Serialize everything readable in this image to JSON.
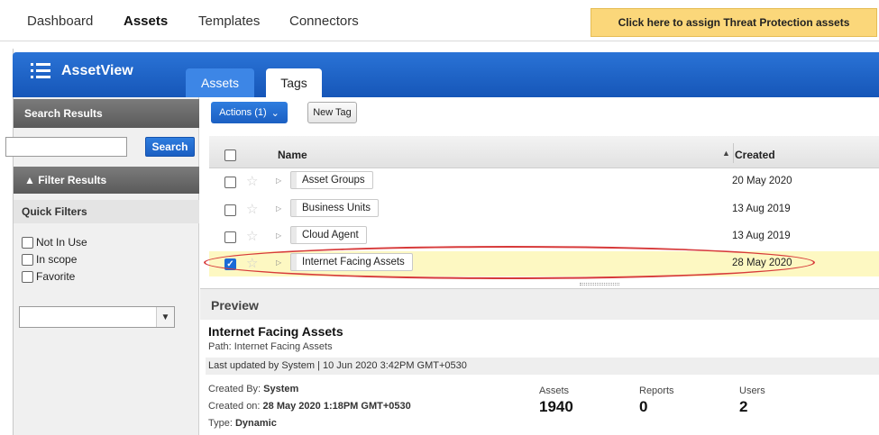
{
  "topnav": {
    "items": [
      "Dashboard",
      "Assets",
      "Templates",
      "Connectors"
    ],
    "active": "Assets",
    "promo": "Click here to assign Threat Protection assets"
  },
  "app": {
    "title": "AssetView",
    "tabs": [
      "Assets",
      "Tags"
    ],
    "selected_tab": "Tags"
  },
  "sidebar": {
    "search_results_title": "Search Results",
    "search_input_value": "",
    "search_button": "Search",
    "filter_title": "▲ Filter Results",
    "quick_filters_title": "Quick Filters",
    "quick_filters": [
      {
        "label": "Not In Use",
        "checked": false
      },
      {
        "label": "In scope",
        "checked": false
      },
      {
        "label": "Favorite",
        "checked": false
      }
    ],
    "select_value": ""
  },
  "toolbar": {
    "actions_label": "Actions (1)",
    "new_tag_label": "New Tag"
  },
  "grid": {
    "columns": {
      "name": "Name",
      "created": "Created",
      "sort_indicator": "▲"
    },
    "rows": [
      {
        "name": "Asset Groups",
        "created": "20 May 2020",
        "checked": false
      },
      {
        "name": "Business Units",
        "created": "13 Aug 2019",
        "checked": false
      },
      {
        "name": "Cloud Agent",
        "created": "13 Aug 2019",
        "checked": false
      },
      {
        "name": "Internet Facing Assets",
        "created": "28 May 2020",
        "checked": true
      }
    ]
  },
  "preview": {
    "header": "Preview",
    "title": "Internet Facing Assets",
    "path": "Path: Internet Facing Assets",
    "last_updated": "Last updated by System  |  10 Jun 2020 3:42PM GMT+0530",
    "created_by_label": "Created By:",
    "created_by": "System",
    "created_on_label": "Created on:",
    "created_on": "28 May 2020 1:18PM GMT+0530",
    "type_label": "Type:",
    "type": "Dynamic",
    "stats": [
      {
        "label": "Assets",
        "value": "1940"
      },
      {
        "label": "Reports",
        "value": "0"
      },
      {
        "label": "Users",
        "value": "2"
      }
    ]
  },
  "colors": {
    "appbar_blue": "#1e64c8",
    "promo_yellow": "#fbd77a",
    "selected_row": "#fdf8c2",
    "highlight_ring": "#d73a3a"
  }
}
